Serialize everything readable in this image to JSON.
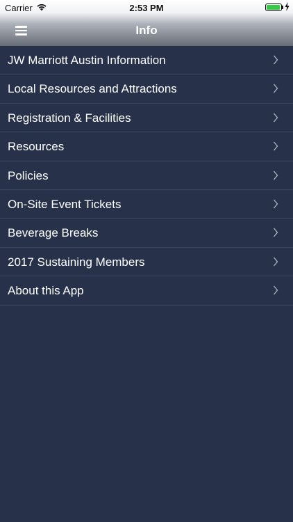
{
  "status_bar": {
    "carrier": "Carrier",
    "time": "2:53 PM",
    "wifi_icon": "wifi-icon",
    "battery_icon": "battery-icon",
    "battery_level": 0.95,
    "charging_icon": "charging-bolt-icon"
  },
  "nav": {
    "title": "Info",
    "menu_icon": "hamburger-menu-icon"
  },
  "colors": {
    "background": "#27324a",
    "separator": "#3a4560",
    "battery_green": "#38c845"
  },
  "items": [
    {
      "label": "JW Marriott Austin Information"
    },
    {
      "label": "Local Resources and Attractions"
    },
    {
      "label": "Registration & Facilities"
    },
    {
      "label": "Resources"
    },
    {
      "label": "Policies"
    },
    {
      "label": "On-Site Event Tickets"
    },
    {
      "label": "Beverage Breaks"
    },
    {
      "label": "2017 Sustaining Members"
    },
    {
      "label": "About this App"
    }
  ]
}
